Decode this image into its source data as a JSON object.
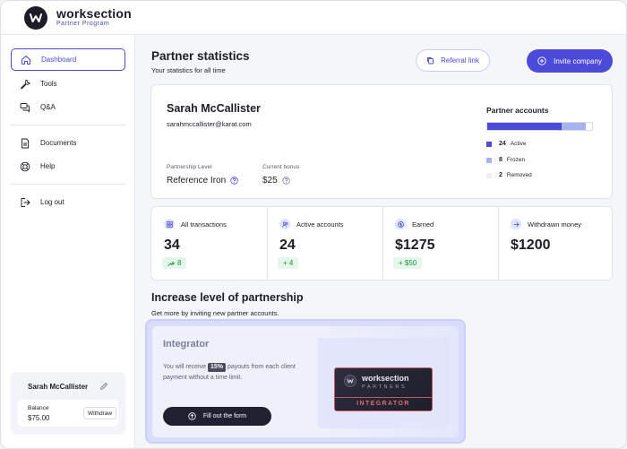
{
  "app": {
    "brand": "worksection",
    "brand_sub": "Partner Program"
  },
  "sidebar": {
    "items": [
      {
        "label": "Dashboard",
        "icon": "home-icon"
      },
      {
        "label": "Tools",
        "icon": "wrench-icon"
      },
      {
        "label": "Q&A",
        "icon": "chat-icon"
      },
      {
        "label": "Documents",
        "icon": "document-icon"
      },
      {
        "label": "Help",
        "icon": "lifebuoy-icon"
      },
      {
        "label": "Log out",
        "icon": "logout-icon"
      }
    ],
    "profile": {
      "name": "Sarah McCallister",
      "balance_label": "Balance",
      "balance_value": "$75.00",
      "withdraw_label": "Withdraw"
    }
  },
  "header": {
    "title": "Partner statistics",
    "subtitle": "Your statistics for all time",
    "referral_label": "Referral link",
    "invite_label": "Invite company"
  },
  "user_card": {
    "name": "Sarah McCallister",
    "email": "sarahmccallister@karat.com",
    "level_label": "Partnership Level",
    "level_value": "Reference Iron",
    "bonus_label": "Current bonus",
    "bonus_value": "$25"
  },
  "partner_accounts": {
    "title": "Partner accounts",
    "items": [
      {
        "count": "24",
        "label": "Active",
        "color": "#4b4ad9"
      },
      {
        "count": "8",
        "label": "Frozen",
        "color": "#a7b2f1"
      },
      {
        "count": "2",
        "label": "Removed",
        "color": "#eeeff4"
      }
    ]
  },
  "stats": [
    {
      "title": "All transactions",
      "value": "34",
      "badge": "8",
      "icon": "grid-icon"
    },
    {
      "title": "Active accounts",
      "value": "24",
      "badge": "+ 4",
      "icon": "users-icon"
    },
    {
      "title": "Earned",
      "value": "$1275",
      "badge": "+ $50",
      "icon": "dollar-icon"
    },
    {
      "title": "Withdrawn money",
      "value": "$1200",
      "icon": "arrow-out-icon"
    }
  ],
  "partnership": {
    "title": "Increase level of partnership",
    "subtitle": "Get more by inviting new partner accounts.",
    "promo": {
      "title": "Integrator",
      "text_before": "You will receive",
      "percent": "15%",
      "text_after": "payouts from each client payment without a time limit.",
      "button_label": "Fill out the form",
      "cert_brand": "worksection",
      "cert_partners": "PARTNERS",
      "cert_type": "INTEGRATOR"
    }
  }
}
